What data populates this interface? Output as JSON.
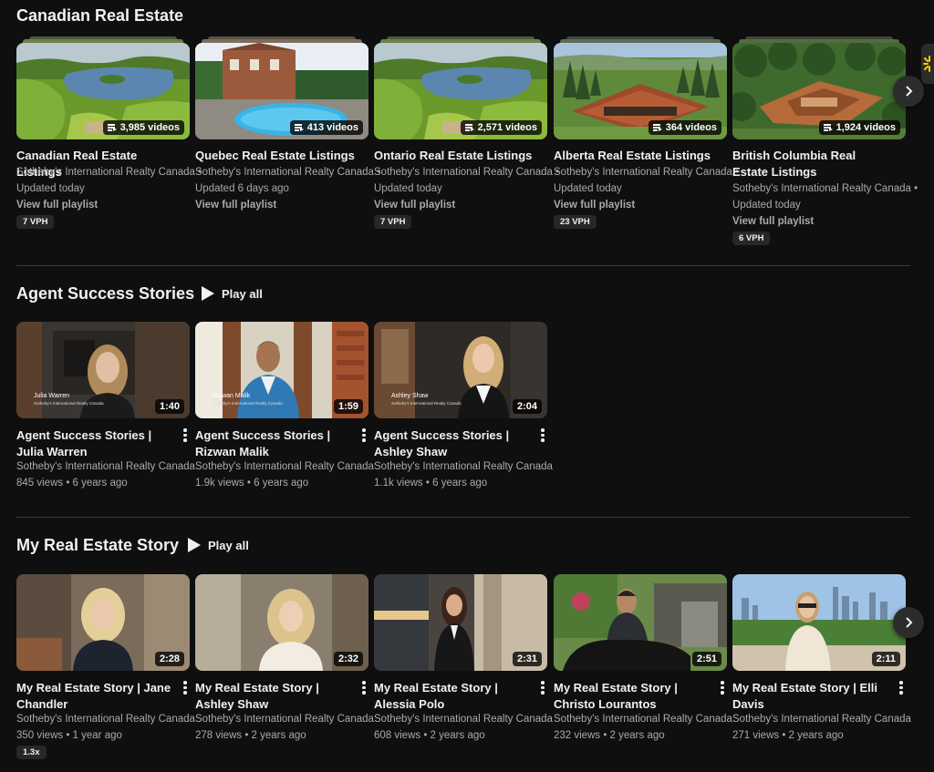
{
  "sections": {
    "canadian": {
      "title": "Canadian Real Estate",
      "cards": [
        {
          "title": "Canadian Real Estate Listings",
          "badge": "3,985 videos",
          "channel": "Sotheby's International Realty Canada •",
          "updated": "Updated today",
          "link": "View full playlist",
          "vph": "7 VPH"
        },
        {
          "title": "Quebec Real Estate Listings",
          "badge": "413 videos",
          "channel": "Sotheby's International Realty Canada •",
          "updated": "Updated 6 days ago",
          "link": "View full playlist",
          "vph": ""
        },
        {
          "title": "Ontario Real Estate Listings",
          "badge": "2,571 videos",
          "channel": "Sotheby's International Realty Canada •",
          "updated": "Updated today",
          "link": "View full playlist",
          "vph": "7 VPH"
        },
        {
          "title": "Alberta Real Estate Listings",
          "badge": "364 videos",
          "channel": "Sotheby's International Realty Canada •",
          "updated": "Updated today",
          "link": "View full playlist",
          "vph": "23 VPH"
        },
        {
          "title": "British Columbia Real Estate Listings",
          "badge": "1,924 videos",
          "channel": "Sotheby's International Realty Canada •",
          "updated": "Updated today",
          "link": "View full playlist",
          "vph": "6 VPH"
        }
      ]
    },
    "agent": {
      "title": "Agent Success Stories",
      "play_all": "Play all",
      "cards": [
        {
          "title": "Agent Success Stories | Julia Warren",
          "duration": "1:40",
          "overlay_name": "Julia Warren",
          "overlay_sub": "Sotheby's International Realty Canada",
          "channel": "Sotheby's International Realty Canada",
          "stats": "845 views • 6 years ago"
        },
        {
          "title": "Agent Success Stories | Rizwan Malik",
          "duration": "1:59",
          "overlay_name": "Rizwan Malik",
          "overlay_sub": "Sotheby's International Realty Canada",
          "channel": "Sotheby's International Realty Canada",
          "stats": "1.9k views • 6 years ago"
        },
        {
          "title": "Agent Success Stories | Ashley Shaw",
          "duration": "2:04",
          "overlay_name": "Ashley Shaw",
          "overlay_sub": "Sotheby's International Realty Canada",
          "channel": "Sotheby's International Realty Canada",
          "stats": "1.1k views • 6 years ago"
        }
      ]
    },
    "story": {
      "title": "My Real Estate Story",
      "play_all": "Play all",
      "cards": [
        {
          "title": "My Real Estate Story | Jane Chandler",
          "duration": "2:28",
          "channel": "Sotheby's International Realty Canada",
          "stats": "350 views • 1 year ago",
          "vph": "1.3x"
        },
        {
          "title": "My Real Estate Story | Ashley Shaw",
          "duration": "2:32",
          "channel": "Sotheby's International Realty Canada",
          "stats": "278 views • 2 years ago",
          "vph": ""
        },
        {
          "title": "My Real Estate Story | Alessia Polo",
          "duration": "2:31",
          "channel": "Sotheby's International Realty Canada",
          "stats": "608 views • 2 years ago",
          "vph": ""
        },
        {
          "title": "My Real Estate Story | Christo Lourantos",
          "duration": "2:51",
          "channel": "Sotheby's International Realty Canada",
          "stats": "232 views • 2 years ago",
          "vph": ""
        },
        {
          "title": "My Real Estate Story | Elli Davis",
          "duration": "2:11",
          "channel": "Sotheby's International Realty Canada",
          "stats": "271 views • 2 years ago",
          "vph": ""
        }
      ]
    }
  },
  "icons": {
    "next": "chevron-right-icon",
    "kebab": "more-vert-icon",
    "playlist": "playlist-icon",
    "play": "play-icon"
  },
  "colors": {
    "background": "#0f0f0f",
    "text": "#f1f1f1",
    "meta": "#aaaaaa",
    "divider": "#3a3a3a",
    "badge_bg": "#272727"
  }
}
